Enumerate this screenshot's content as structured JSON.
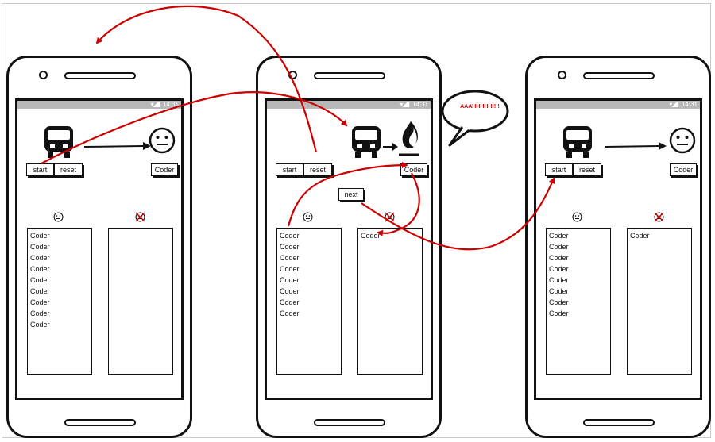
{
  "status": {
    "time": "14:31"
  },
  "phones": [
    {
      "id": "left",
      "start_label": "start",
      "reset_label": "reset",
      "card_label": "Coder",
      "left_list": [
        "Coder",
        "Coder",
        "Coder",
        "Coder",
        "Coder",
        "Coder",
        "Coder",
        "Coder",
        "Coder"
      ],
      "right_list": []
    },
    {
      "id": "middle",
      "start_label": "start",
      "reset_label": "reset",
      "card_label": "Coder",
      "left_list": [
        "Coder",
        "Coder",
        "Coder",
        "Coder",
        "Coder",
        "Coder",
        "Coder",
        "Coder"
      ],
      "right_list": [
        "Coder"
      ]
    },
    {
      "id": "right",
      "start_label": "start",
      "reset_label": "reset",
      "card_label": "Coder",
      "left_list": [
        "Coder",
        "Coder",
        "Coder",
        "Coder",
        "Coder",
        "Coder",
        "Coder",
        "Coder"
      ],
      "right_list": [
        "Coder"
      ]
    }
  ],
  "next_label": "next",
  "speech_bubble": "AAAHHHHH!!!!",
  "colors": {
    "annotation": "#cc0000",
    "ink": "#111111",
    "statusbar": "#b8b8b8"
  },
  "icons": [
    "bus-icon",
    "smiley-neutral-icon",
    "fire-icon",
    "arrow-right-icon",
    "smiley-small-icon",
    "crossed-smiley-icon"
  ]
}
